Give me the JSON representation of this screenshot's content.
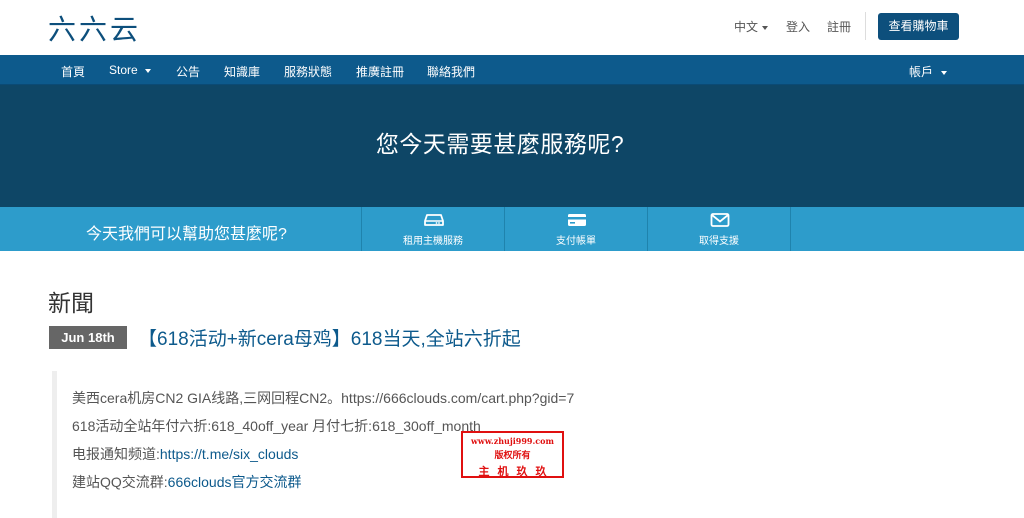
{
  "header": {
    "logo": "六六云",
    "language": "中文",
    "login": "登入",
    "register": "註冊",
    "cart_button": "查看購物車"
  },
  "nav": {
    "items": [
      "首頁",
      "Store",
      "公告",
      "知識庫",
      "服務狀態",
      "推廣註冊",
      "聯絡我們"
    ],
    "account": "帳戶"
  },
  "hero": {
    "title": "您今天需要甚麼服務呢?"
  },
  "help": {
    "text": "今天我們可以幫助您甚麼呢?",
    "actions": [
      {
        "label": "租用主機服務",
        "icon": "server-icon"
      },
      {
        "label": "支付帳單",
        "icon": "credit-card-icon"
      },
      {
        "label": "取得支援",
        "icon": "envelope-icon"
      }
    ]
  },
  "news": {
    "heading": "新聞",
    "date": "Jun 18th",
    "title": "【618活动+新cera母鸡】618当天,全站六折起",
    "lines": {
      "l1": "美西cera机房CN2 GIA线路,三网回程CN2。https://666clouds.com/cart.php?gid=7",
      "l2": "618活动全站年付六折:618_40off_year   月付七折:618_30off_month",
      "l3_prefix": "电报通知频道:",
      "l3_link": "https://t.me/six_clouds",
      "l4_prefix": "建站QQ交流群:",
      "l4_link": "666clouds官方交流群"
    }
  },
  "stamp": {
    "url": "www.zhuji999.com",
    "rights": "版权所有",
    "name": "主机玖玖"
  },
  "colors": {
    "brand": "#0d4f7c",
    "nav": "#0d5a8c",
    "hero": "#0e4666",
    "help": "#2d9ccb",
    "stamp": "#e01010"
  }
}
